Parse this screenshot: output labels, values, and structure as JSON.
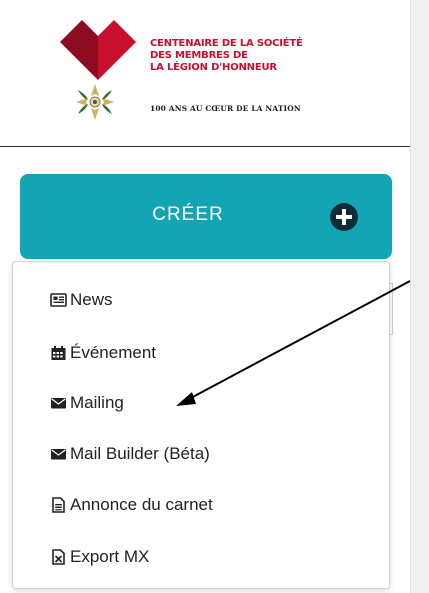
{
  "brand": {
    "lines": [
      "CENTENAIRE DE LA SOCIÉTÉ",
      "DES MEMBRES DE",
      "LA LÉGION D'HONNEUR"
    ],
    "tagline": "100 ANS AU CŒUR DE LA NATION",
    "colors": {
      "red": "#c8102e",
      "dark_red": "#8e0c22",
      "green": "#3d6b3a",
      "gold": "#c9b268"
    }
  },
  "create_button": {
    "label": "CRÉER",
    "icon": "plus-circle-icon",
    "color": "#13a5b4"
  },
  "menu": {
    "items": [
      {
        "label": "News",
        "icon": "newspaper-icon"
      },
      {
        "label": "Événement",
        "icon": "calendar-icon"
      },
      {
        "label": "Mailing",
        "icon": "envelope-icon"
      },
      {
        "label": "Mail Builder (Béta)",
        "icon": "envelope-icon"
      },
      {
        "label": "Annonce du carnet",
        "icon": "file-text-icon"
      },
      {
        "label": "Export MX",
        "icon": "file-excel-icon"
      }
    ]
  },
  "annotation": {
    "arrow_points_to": "Mailing"
  }
}
